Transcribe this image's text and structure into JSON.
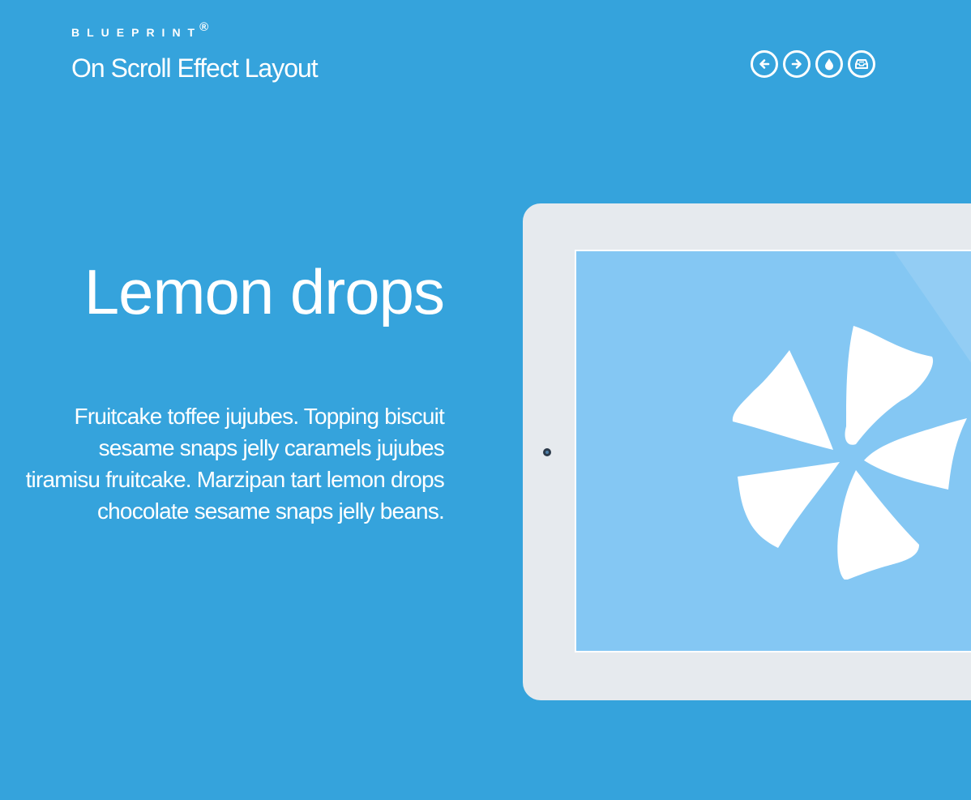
{
  "header": {
    "brand": "BLUEPRINT",
    "brand_mark": "®",
    "title": "On Scroll Effect Layout"
  },
  "nav_icons": [
    {
      "icon": "arrow-left-circle-icon"
    },
    {
      "icon": "arrow-right-circle-icon"
    },
    {
      "icon": "drop-icon"
    },
    {
      "icon": "archive-tray-icon"
    }
  ],
  "section": {
    "heading": "Lemon drops",
    "paragraph": "Fruitcake toffee jujubes. Topping biscuit sesame snaps jelly caramels jujubes tiramisu fruitcake. Marzipan tart lemon drops chocolate sesame snaps jelly beans."
  },
  "device": {
    "screen_icon": "pinwheel-flower-icon"
  },
  "colors": {
    "background": "#35a3dc",
    "tablet_frame": "#e6eaee",
    "tablet_screen": "#84c7f3",
    "text": "#ffffff"
  }
}
